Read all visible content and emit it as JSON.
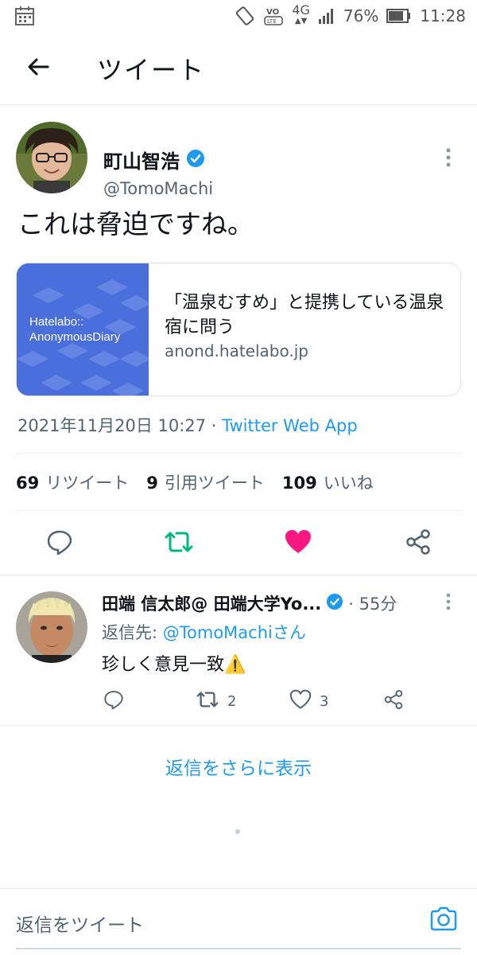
{
  "status_bar": {
    "battery_percent": "76%",
    "time": "11:28",
    "network": "4G",
    "volte": "VoLTE",
    "icons": [
      "calendar-icon",
      "rotate-icon",
      "volte-icon",
      "4g-icon",
      "signal-icon",
      "battery-icon"
    ]
  },
  "header": {
    "title": "ツイート",
    "back_icon": "arrow-left-icon"
  },
  "tweet": {
    "author_name": "町山智浩",
    "author_handle": "@TomoMachi",
    "verified": true,
    "text": "これは脅迫ですね。",
    "card": {
      "thumb_line1": "Hatelabo::",
      "thumb_line2": "AnonymousDiary",
      "title": "「温泉むすめ」と提携している温泉宿に問う",
      "domain": "anond.hatelabo.jp",
      "thumb_color": "#4a6fdc"
    },
    "timestamp": "2021年11月20日 10:27",
    "separator": " · ",
    "source": "Twitter Web App",
    "stats": {
      "retweets_count": "69",
      "retweets_label": "リツイート",
      "quotes_count": "9",
      "quotes_label": "引用ツイート",
      "likes_count": "109",
      "likes_label": "いいね"
    },
    "liked": true
  },
  "reply": {
    "author_name": "田端 信太郎@ 田端大学Yo...",
    "verified": true,
    "time": "· 55分",
    "reply_to_prefix": "返信先: ",
    "reply_to_mention": "@TomoMachiさん",
    "text": "珍しく意見一致⚠️",
    "retweet_count": "2",
    "like_count": "3"
  },
  "show_more": "返信をさらに表示",
  "compose": {
    "placeholder": "返信をツイート"
  },
  "colors": {
    "accent": "#1d9bf0",
    "retweet": "#00ba7c",
    "like": "#f91880",
    "text_secondary": "#536471"
  }
}
